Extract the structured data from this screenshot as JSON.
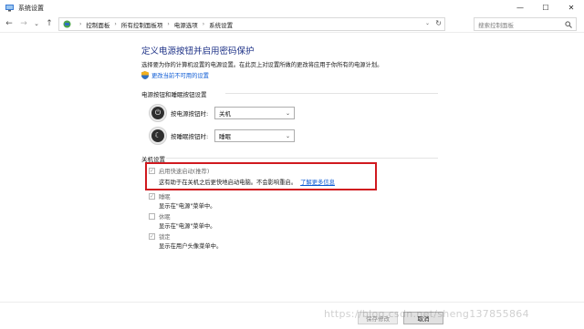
{
  "window": {
    "title": "系统设置",
    "controls": {
      "minimize": "—",
      "maximize": "☐",
      "close": "✕"
    }
  },
  "nav": {
    "back": "←",
    "forward": "→",
    "recent": "⌄",
    "up": "↑"
  },
  "breadcrumb": {
    "items": [
      "控制面板",
      "所有控制面板项",
      "电源选项",
      "系统设置"
    ],
    "separator": "›",
    "dropdown": "⌄",
    "refresh": "↻"
  },
  "search": {
    "placeholder": "搜索控制面板",
    "icon": "search-icon"
  },
  "page": {
    "title": "定义电源按钮并启用密码保护",
    "description": "选择要为你的计算机设置的电源设置。在此页上对设置所做的更改将应用于你所有的电源计划。",
    "change_link": "更改当前不可用的设置"
  },
  "power_section": {
    "title": "电源按钮和睡眠按钮设置",
    "power_button": {
      "label": "按电源按钮时:",
      "value": "关机",
      "icon": "power-icon"
    },
    "sleep_button": {
      "label": "按睡眠按钮时:",
      "value": "睡眠",
      "icon": "moon-icon"
    }
  },
  "shutdown_section": {
    "title": "关机设置",
    "fast_startup": {
      "label": "启用快速启动(推荐)",
      "checked": true,
      "description": "这有助于在关机之后更快地启动电脑。不会影响重启。",
      "learn_more": "了解更多信息"
    },
    "sleep": {
      "label": "睡眠",
      "checked": true,
      "description": "显示在\"电源\"菜单中。"
    },
    "hibernate": {
      "label": "休眠",
      "checked": false,
      "description": "显示在\"电源\"菜单中。"
    },
    "lock": {
      "label": "锁定",
      "checked": true,
      "description": "显示在用户头像菜单中。"
    }
  },
  "footer": {
    "save": "保存修改",
    "cancel": "取消"
  },
  "watermark": "https://blog.csdn.net/sheng137855864",
  "colors": {
    "title": "#1e3287",
    "link": "#0b5ad4",
    "highlight": "#d0191f"
  }
}
